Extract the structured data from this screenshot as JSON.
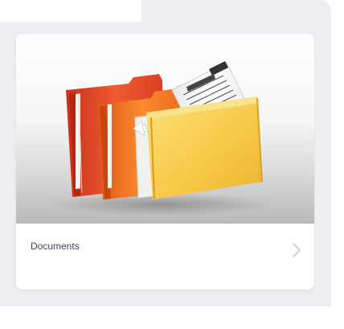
{
  "card": {
    "title": "Documents"
  },
  "icons": {
    "image": "folders-with-documents-image",
    "chevron": "chevron-right-icon"
  },
  "colors": {
    "panel_background": "#eceef2",
    "card_background": "#ffffff",
    "title_text": "#3d4450",
    "chevron": "#c4c8cf",
    "folder_red": "#e7492c",
    "folder_orange": "#f4721d",
    "folder_yellow": "#f6c94c"
  }
}
